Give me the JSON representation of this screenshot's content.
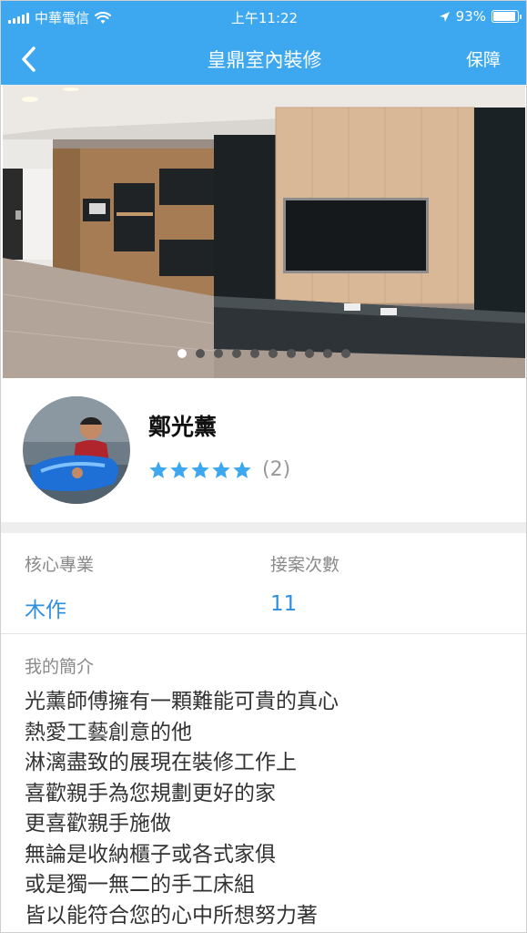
{
  "status_bar": {
    "carrier": "中華電信",
    "time": "上午11:22",
    "battery": "93%",
    "battery_level": 0.93
  },
  "nav": {
    "title": "皇鼎室內裝修",
    "action": "保障"
  },
  "carousel": {
    "slide_count": 10,
    "active_index": 0
  },
  "profile": {
    "name": "鄭光薰",
    "rating_stars": 5,
    "rating_count": "(2)"
  },
  "stats": {
    "specialty_label": "核心專業",
    "specialty_value": "木作",
    "cases_label": "接案次數",
    "cases_value": "11"
  },
  "intro": {
    "label": "我的簡介",
    "lines": [
      "光薰師傅擁有一顆難能可貴的真心",
      "熱愛工藝創意的他",
      "淋漓盡致的展現在裝修工作上",
      "喜歡親手為您規劃更好的家",
      "更喜歡親手施做",
      "無論是收納櫃子或各式家俱",
      "或是獨一無二的手工床組",
      "皆以能符合您的心中所想努力著"
    ]
  },
  "colors": {
    "header": "#3da8f0",
    "accent": "#2e8fe0",
    "star": "#3da8f0"
  }
}
